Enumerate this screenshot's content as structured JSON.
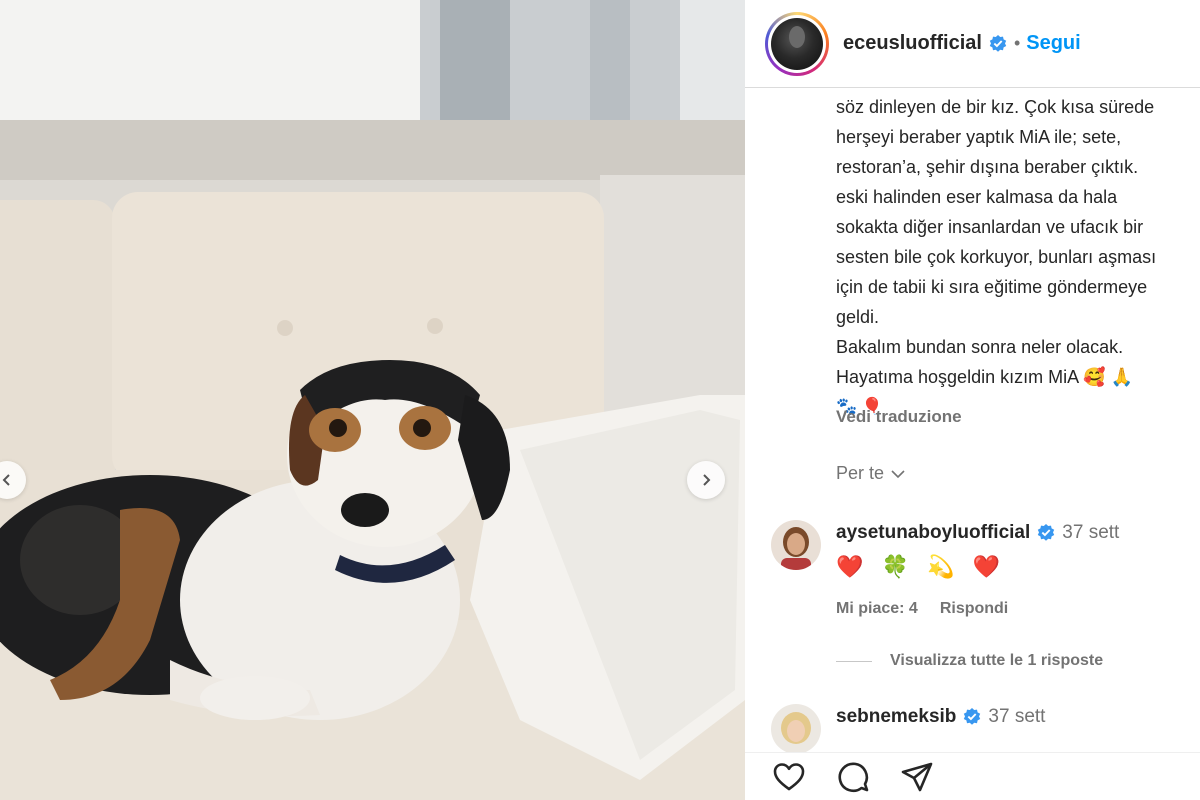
{
  "post": {
    "username": "eceusluofficial",
    "follow_label": "Segui",
    "separator": "•",
    "caption_lines": [
      "söz dinleyen de bir kız. Çok kısa sürede",
      "herşeyi beraber yaptık MiA ile; sete,",
      "restoran’a, şehir dışına beraber çıktık.",
      "eski halinden eser kalmasa da hala",
      "sokakta diğer insanlardan ve ufacık bir",
      "sesten bile çok korkuyor, bunları aşması",
      "için de tabii ki sıra eğitime göndermeye",
      "geldi.",
      "Bakalım bundan sonra neler olacak.",
      "Hayatıma hoşgeldin kızım MiA 🥰 🙏",
      "🐾 🎈"
    ],
    "see_translation": "Vedi traduzione",
    "for_you": "Per te"
  },
  "comments": [
    {
      "username": "aysetunaboyluofficial",
      "time": "37 sett",
      "text": "❤️ 🍀 💫 ❤️",
      "likes": "Mi piace: 4",
      "reply": "Rispondi"
    },
    {
      "username": "sebnemeksib",
      "time": "37 sett"
    }
  ],
  "view_replies": "Visualizza tutte le 1 risposte",
  "icons": {
    "verified": "verified-badge-icon",
    "like": "heart-icon",
    "comment": "comment-icon",
    "share": "share-icon",
    "prev": "chevron-left-icon",
    "next": "chevron-right-icon",
    "chevron": "chevron-down-icon"
  },
  "colors": {
    "accent": "#0095f6",
    "verified": "#3897f0",
    "muted": "#737373",
    "text": "#262626"
  }
}
